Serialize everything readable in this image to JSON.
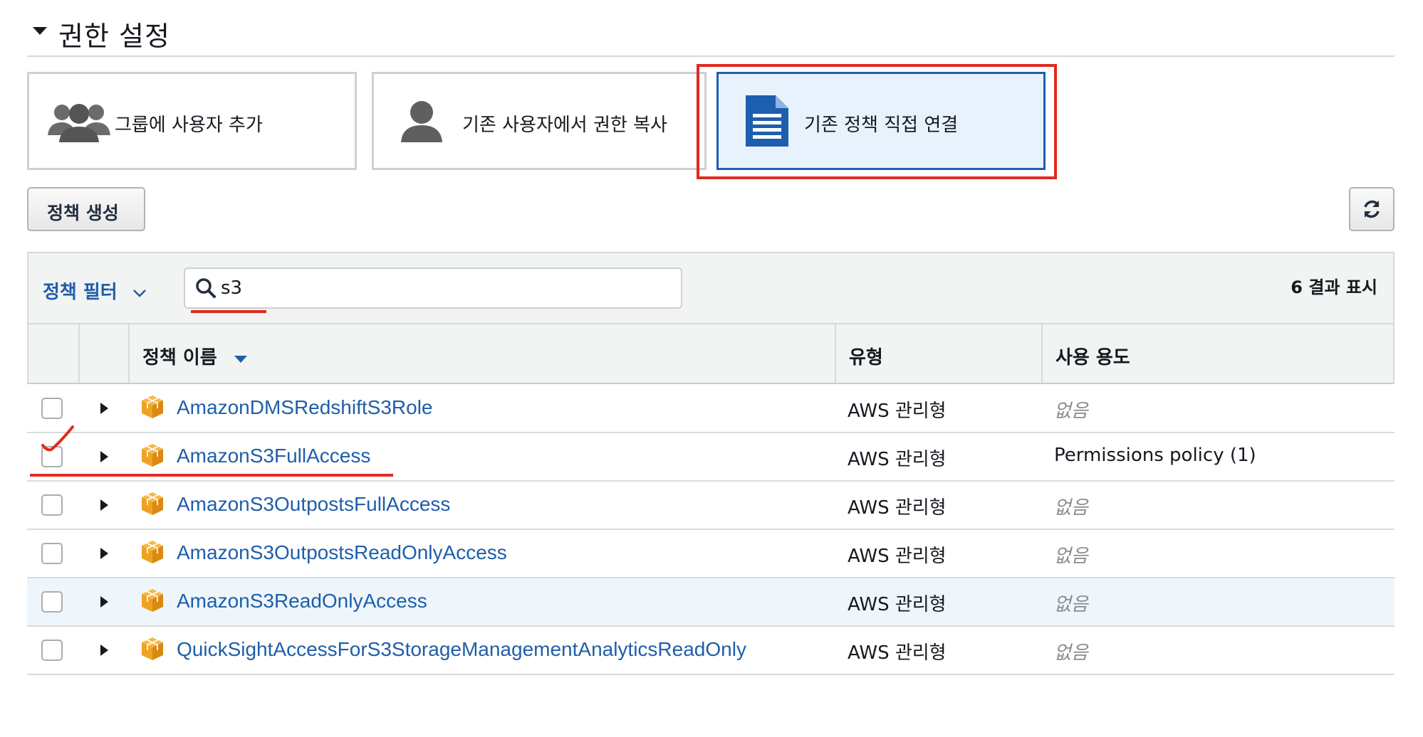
{
  "section": {
    "title": "권한 설정"
  },
  "options": [
    {
      "label": "그룹에 사용자 추가",
      "icon": "users-group-icon",
      "selected": false
    },
    {
      "label": "기존 사용자에서 권한 복사",
      "icon": "user-icon",
      "selected": false
    },
    {
      "label": "기존 정책 직접 연결",
      "icon": "document-icon",
      "selected": true
    }
  ],
  "toolbar": {
    "create_policy_label": "정책 생성",
    "refresh_icon": "refresh-icon"
  },
  "filter": {
    "label": "정책 필터",
    "search_value": "s3",
    "results_label": "6 결과 표시"
  },
  "table": {
    "headers": {
      "name": "정책 이름",
      "type": "유형",
      "usage": "사용 용도"
    },
    "rows": [
      {
        "name": "AmazonDMSRedshiftS3Role",
        "type": "AWS 관리형",
        "usage": "없음",
        "checked": false
      },
      {
        "name": "AmazonS3FullAccess",
        "type": "AWS 관리형",
        "usage": "Permissions policy (1)",
        "checked": false
      },
      {
        "name": "AmazonS3OutpostsFullAccess",
        "type": "AWS 관리형",
        "usage": "없음",
        "checked": false
      },
      {
        "name": "AmazonS3OutpostsReadOnlyAccess",
        "type": "AWS 관리형",
        "usage": "없음",
        "checked": false
      },
      {
        "name": "AmazonS3ReadOnlyAccess",
        "type": "AWS 관리형",
        "usage": "없음",
        "checked": false
      },
      {
        "name": "QuickSightAccessForS3StorageManagementAnalyticsReadOnly",
        "type": "AWS 관리형",
        "usage": "없음",
        "checked": false
      }
    ]
  },
  "colors": {
    "link": "#1f5ea8",
    "selected_border": "#1d5fae",
    "annotation": "#e02b1f",
    "aws_cube": "#f0a224"
  }
}
